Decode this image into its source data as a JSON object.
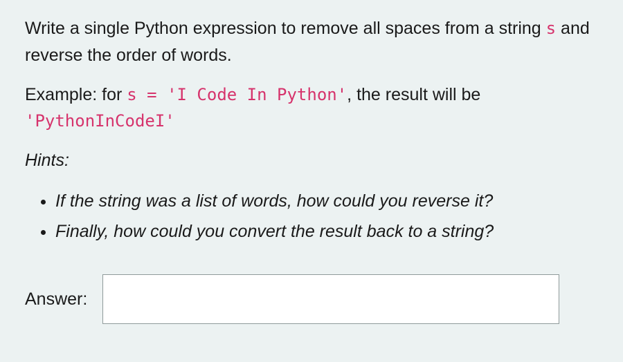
{
  "para1": {
    "t1": "Write a single Python expression to remove all spaces from a string ",
    "code": "s",
    "t2": " and reverse the order of words."
  },
  "para2": {
    "t1": "Example: for ",
    "code1": "s = 'I Code In Python'",
    "t2": ", the result will be ",
    "code2": "'PythonInCodeI'"
  },
  "hints_label": "Hints:",
  "hints": [
    "If the string was a list of words, how could you reverse it?",
    "Finally, how could you convert the result back to a string?"
  ],
  "answer_label": "Answer:",
  "answer_value": ""
}
